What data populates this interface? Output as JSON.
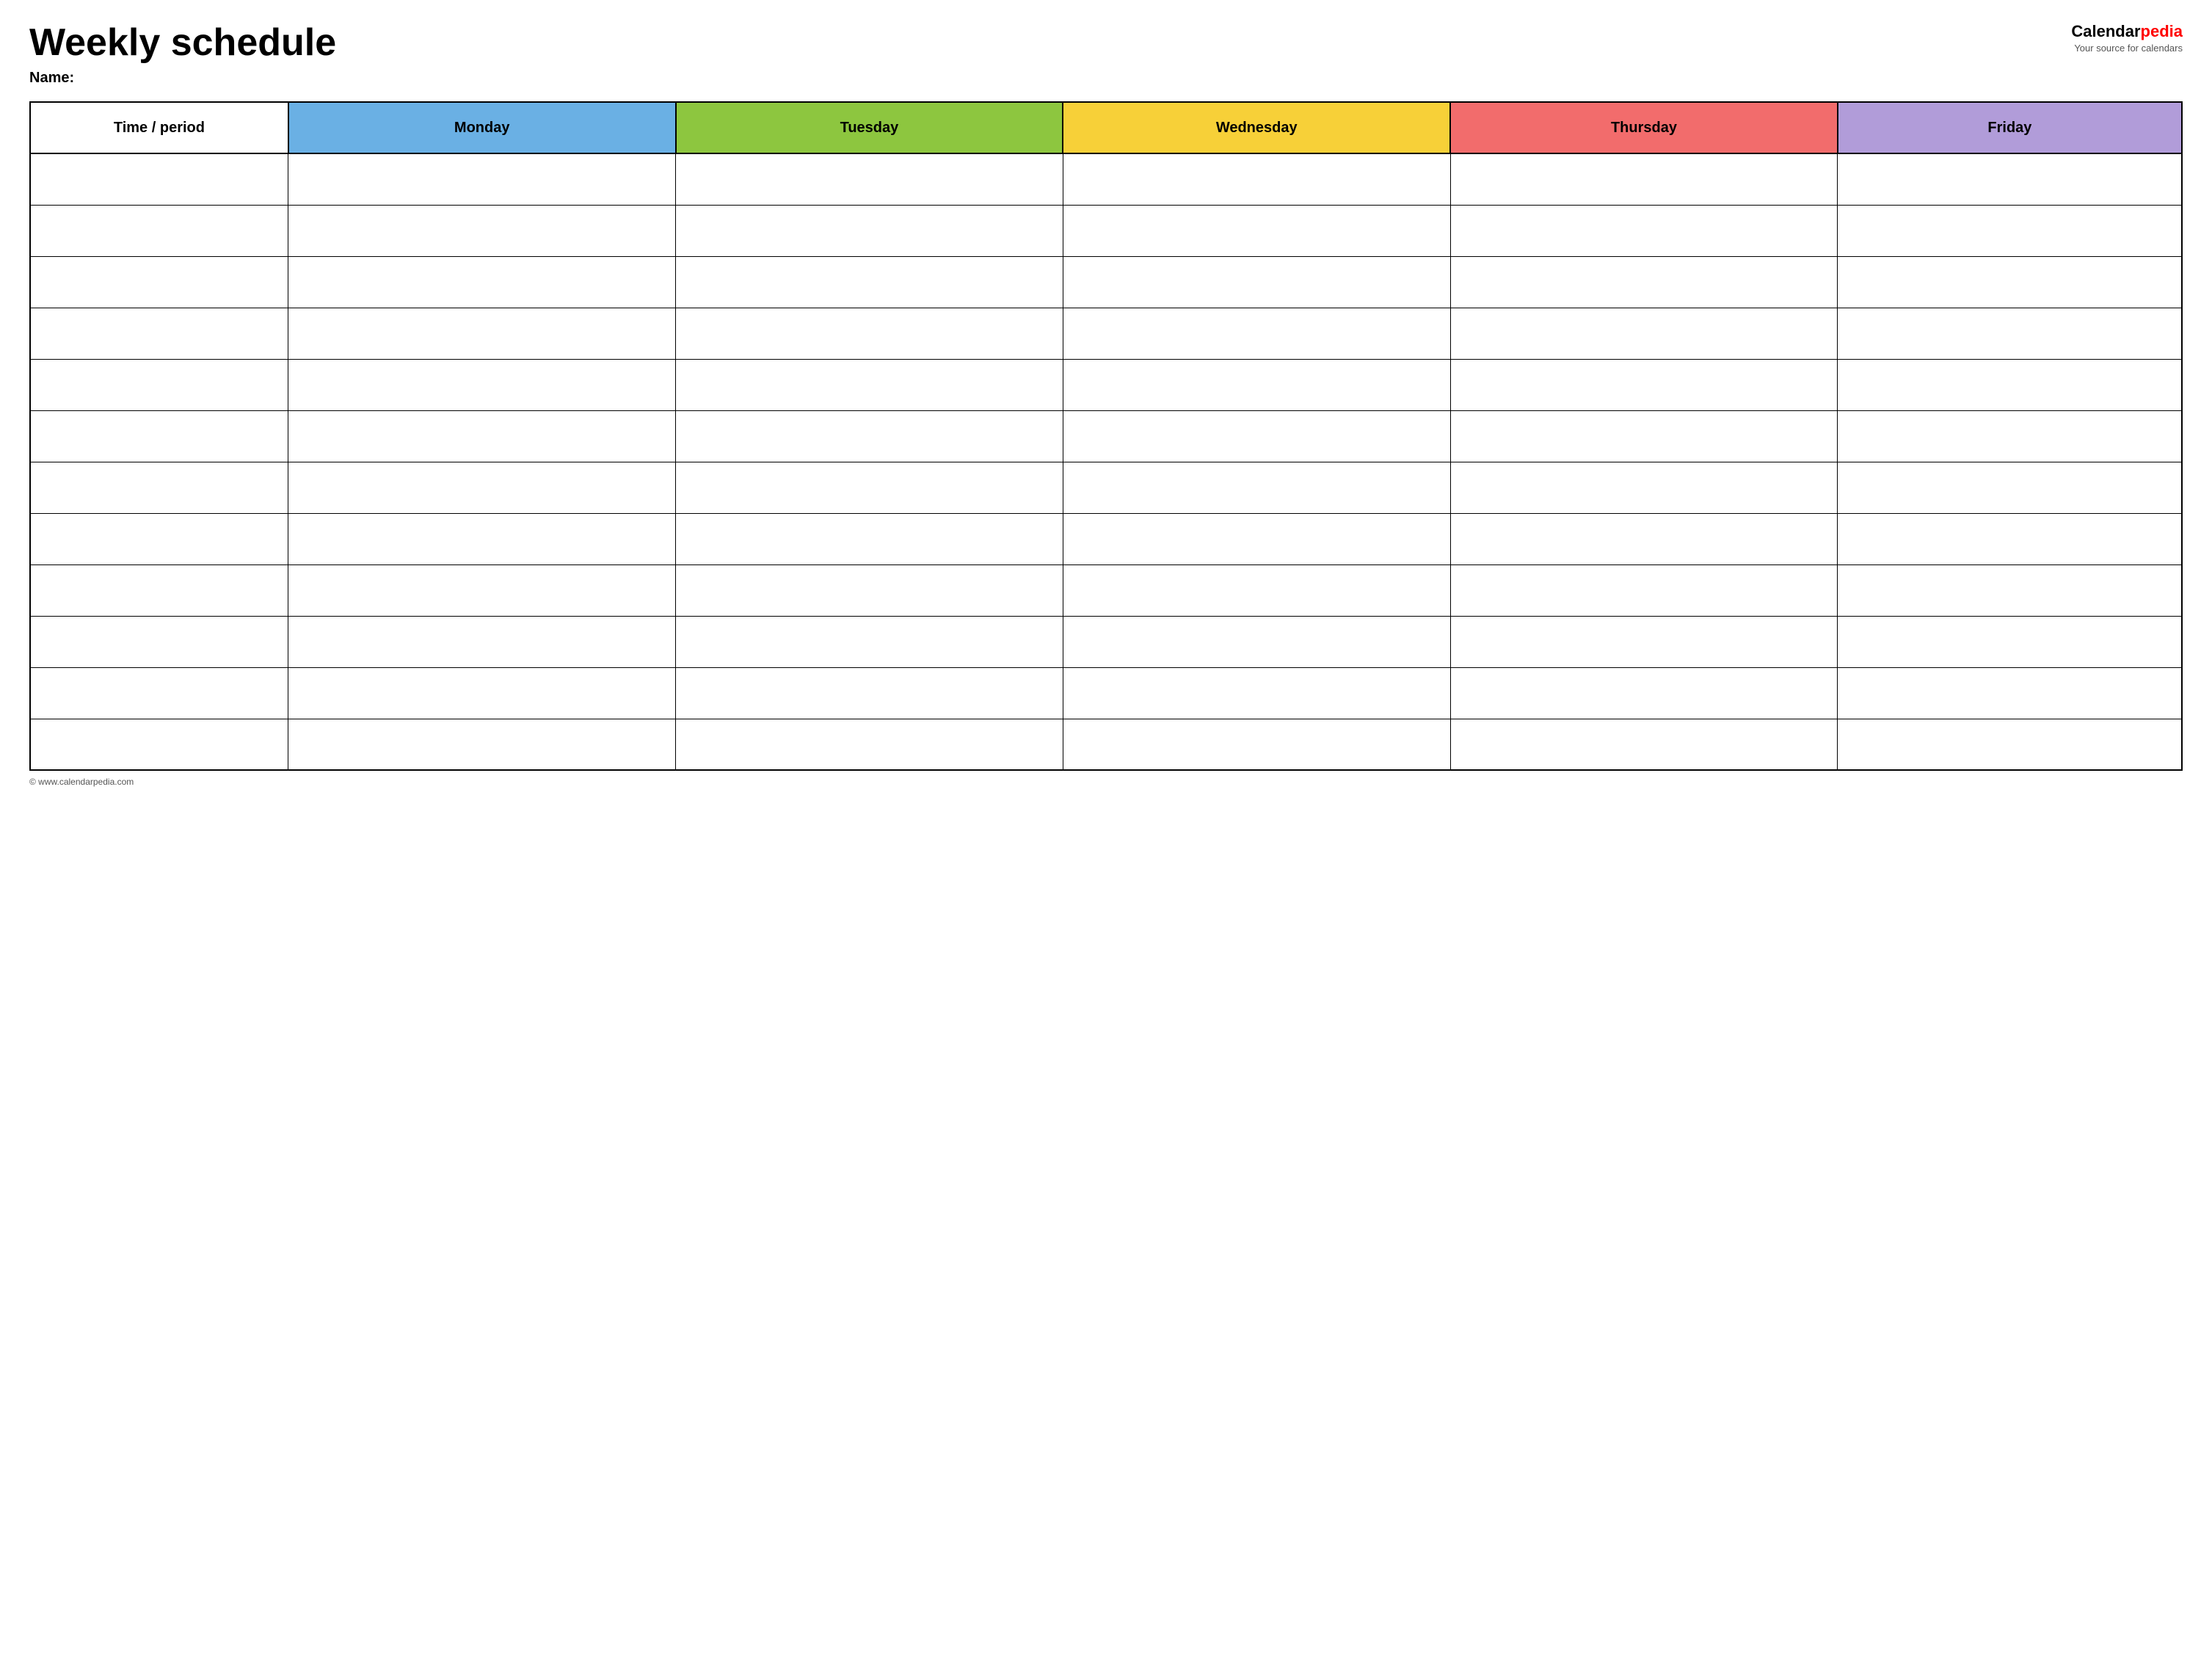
{
  "header": {
    "title": "Weekly schedule",
    "name_label": "Name:",
    "logo_calendar": "Calendar",
    "logo_pedia": "pedia",
    "logo_subtitle": "Your source for calendars"
  },
  "table": {
    "columns": [
      {
        "key": "time",
        "label": "Time / period",
        "color": "#ffffff",
        "class": "col-time"
      },
      {
        "key": "monday",
        "label": "Monday",
        "color": "#6ab0e4",
        "class": "col-monday"
      },
      {
        "key": "tuesday",
        "label": "Tuesday",
        "color": "#8dc63f",
        "class": "col-tuesday"
      },
      {
        "key": "wednesday",
        "label": "Wednesday",
        "color": "#f7d038",
        "class": "col-wednesday"
      },
      {
        "key": "thursday",
        "label": "Thursday",
        "color": "#f26c6c",
        "class": "col-thursday"
      },
      {
        "key": "friday",
        "label": "Friday",
        "color": "#b19cd9",
        "class": "col-friday"
      }
    ],
    "row_count": 12
  },
  "footer": {
    "text": "© www.calendarpedia.com"
  }
}
